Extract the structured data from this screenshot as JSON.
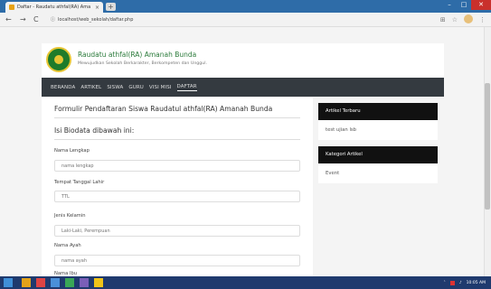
{
  "browser": {
    "tab_title": "Daftar - Raudatu athfal(RA) Ama",
    "tab_close": "×",
    "new_tab": "+",
    "back": "←",
    "forward": "→",
    "reload": "C",
    "info": "ⓘ",
    "url": "localhost/web_sekolah/daftar.php",
    "min": "–",
    "max": "□",
    "close": "✕"
  },
  "site": {
    "title": "Raudatu athfal(RA) Amanah Bunda",
    "subtitle": "Mewujudkan Sekolah Berkarakter, Berkompeten dan Unggul."
  },
  "nav": {
    "items": [
      "BERANDA",
      "ARTIKEL",
      "SISWA",
      "GURU",
      "VISI MISI",
      "DAFTAR"
    ]
  },
  "form": {
    "title": "Formulir Pendaftaran Siswa Raudatul athfal(RA) Amanah Bunda",
    "subtitle": "Isi Biodata dibawah ini:",
    "fields": [
      {
        "label": "Nama Lengkap",
        "placeholder": "nama lengkap"
      },
      {
        "label": "Tempat Tanggal Lahir",
        "placeholder": "TTL"
      },
      {
        "label": "Jenis Kelamin",
        "placeholder": "Laki-Laki, Perempuan"
      },
      {
        "label": "Nama Ayah",
        "placeholder": "nama ayah"
      },
      {
        "label": "Nama Ibu",
        "placeholder": ""
      }
    ]
  },
  "sidebar": {
    "recent_title": "Artikel Terbaru",
    "recent_item": "test ujian lsb",
    "category_title": "Kategori Artikel",
    "category_item": "Event"
  },
  "taskbar": {
    "clock": "10:05 AM"
  },
  "colors": {
    "browser_frame": "#2e6ca8",
    "navbar": "#343a40",
    "site_title": "#2a7a3a",
    "sidebar_head": "#111111",
    "taskbar": "#1f3a6e"
  }
}
